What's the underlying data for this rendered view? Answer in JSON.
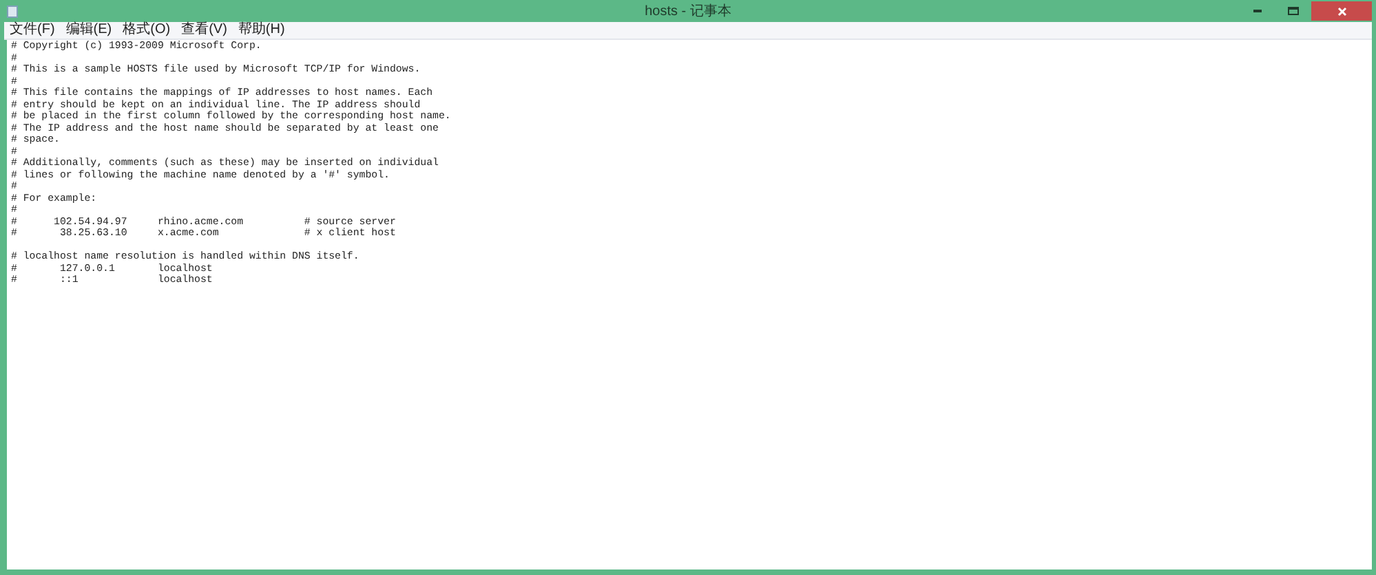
{
  "window": {
    "title": "hosts - 记事本"
  },
  "menu": [
    {
      "label": "文件(F)"
    },
    {
      "label": "编辑(E)"
    },
    {
      "label": "格式(O)"
    },
    {
      "label": "查看(V)"
    },
    {
      "label": "帮助(H)"
    }
  ],
  "document": {
    "blocks": [
      [
        "# Copyright (c) 1993-2009 Microsoft Corp.",
        "#",
        "# This is a sample HOSTS file used by Microsoft TCP/IP for Windows.",
        "#",
        "# This file contains the mappings of IP addresses to host names. Each",
        "# entry should be kept on an individual line. The IP address should",
        "# be placed in the first column followed by the corresponding host name.",
        "# The IP address and the host name should be separated by at least one",
        "# space.",
        "#",
        "# Additionally, comments (such as these) may be inserted on individual",
        "# lines or following the machine name denoted by a '#' symbol.",
        "#",
        "# For example:",
        "#",
        "#      102.54.94.97     rhino.acme.com          # source server",
        "#       38.25.63.10     x.acme.com              # x client host"
      ],
      [
        "# localhost name resolution is handled within DNS itself.",
        "#       127.0.0.1       localhost",
        "#       ::1             localhost"
      ]
    ]
  }
}
